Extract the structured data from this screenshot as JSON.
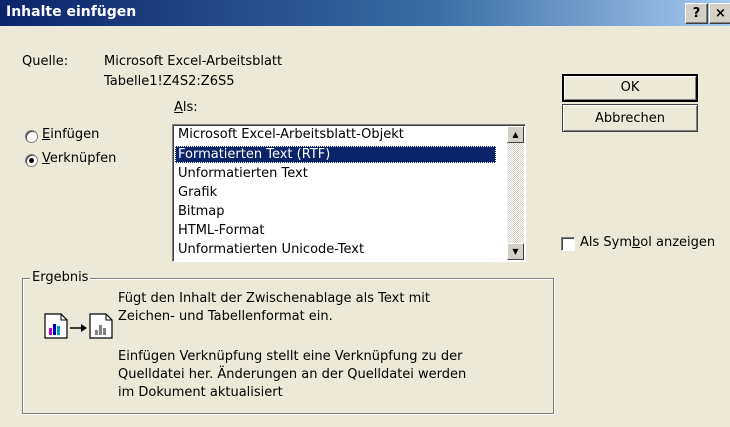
{
  "titlebar": {
    "title": "Inhalte einfügen",
    "help_label": "?",
    "close_label": "×"
  },
  "source": {
    "label": "Quelle:",
    "app": "Microsoft Excel-Arbeitsblatt",
    "range": "Tabelle1!Z4S2:Z6S5"
  },
  "as_label": {
    "pre": "",
    "mnemonic": "A",
    "post": "ls:"
  },
  "options": {
    "paste": {
      "mnemonic": "E",
      "rest": "infügen",
      "checked": false
    },
    "link": {
      "mnemonic": "V",
      "rest": "erknüpfen",
      "checked": true
    }
  },
  "formats": [
    "Microsoft Excel-Arbeitsblatt-Objekt",
    "Formatierten Text (RTF)",
    "Unformatierten Text",
    "Grafik",
    "Bitmap",
    "HTML-Format",
    "Unformatierten Unicode-Text"
  ],
  "selected_format_index": 1,
  "buttons": {
    "ok": "OK",
    "cancel": "Abbrechen"
  },
  "display_as_icon": {
    "pre": "Als Sym",
    "mnemonic": "b",
    "post": "ol anzeigen",
    "checked": false
  },
  "result": {
    "label": "Ergebnis",
    "line1": "Fügt den Inhalt der Zwischenablage als Text mit",
    "line2": "Zeichen- und Tabellenformat ein.",
    "line3": "Einfügen Verknüpfung stellt eine Verknüpfung zu der",
    "line4": "Quelldatei her. Änderungen an der Quelldatei werden",
    "line5": "im Dokument aktualisiert"
  },
  "colors": {
    "title_bar": "#0a246a",
    "selection": "#0a246a",
    "dialog_bg": "#ece9d8"
  }
}
